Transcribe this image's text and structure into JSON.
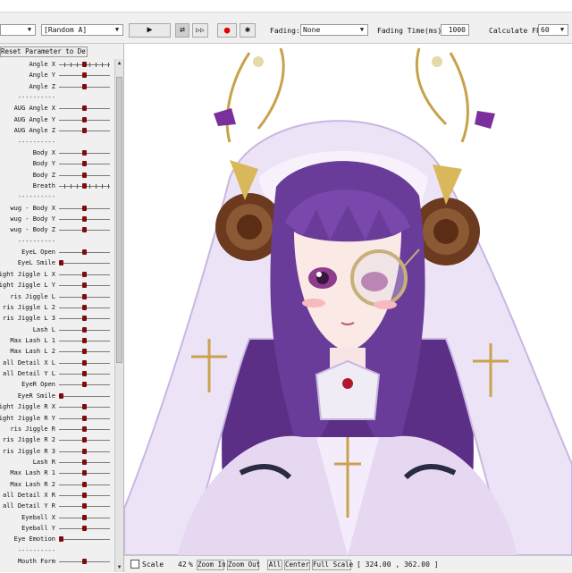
{
  "toolbar": {
    "motion_select": "",
    "preset_select": "[Random A]",
    "play_icon": "▶",
    "loop_icon": "⇄",
    "skip_icon": "▷▷",
    "record_icon": "●",
    "settings_icon": "✱",
    "fading_label": "Fading:",
    "fading_value": "None",
    "fading_time_label": "Fading Time(ms):",
    "fading_time_value": "1000",
    "fps_label": "Calculate FPS",
    "fps_value": "60"
  },
  "params": {
    "reset_label": "Reset Parameter to Default",
    "rows": [
      {
        "label": "Angle X",
        "knob": "ticks"
      },
      {
        "label": "Angle Y",
        "knob": "center"
      },
      {
        "label": "Angle Z",
        "knob": "center"
      },
      {
        "label": "----------",
        "knob": "none"
      },
      {
        "label": "AUG Angle X",
        "knob": "center"
      },
      {
        "label": "AUG Angle Y",
        "knob": "center"
      },
      {
        "label": "AUG Angle Z",
        "knob": "center"
      },
      {
        "label": "----------",
        "knob": "none"
      },
      {
        "label": "Body X",
        "knob": "center"
      },
      {
        "label": "Body Y",
        "knob": "center"
      },
      {
        "label": "Body Z",
        "knob": "center"
      },
      {
        "label": "Breath",
        "knob": "ticks"
      },
      {
        "label": "----------",
        "knob": "none"
      },
      {
        "label": "wug - Body X",
        "knob": "center"
      },
      {
        "label": "wug - Body Y",
        "knob": "center"
      },
      {
        "label": "wug - Body Z",
        "knob": "center"
      },
      {
        "label": "----------",
        "knob": "none"
      },
      {
        "label": "EyeL Open",
        "knob": "center"
      },
      {
        "label": "EyeL Smile",
        "knob": "start"
      },
      {
        "label": "ight Jiggle L X",
        "knob": "center"
      },
      {
        "label": "ight Jiggle L Y",
        "knob": "center"
      },
      {
        "label": "ris Jiggle L",
        "knob": "center"
      },
      {
        "label": "ris Jiggle L 2",
        "knob": "center"
      },
      {
        "label": "ris Jiggle L 3",
        "knob": "center"
      },
      {
        "label": "Lash L",
        "knob": "center"
      },
      {
        "label": "Max Lash L 1",
        "knob": "center"
      },
      {
        "label": "Max Lash L 2",
        "knob": "center"
      },
      {
        "label": "all Detail X L",
        "knob": "center"
      },
      {
        "label": "all Detail Y L",
        "knob": "center"
      },
      {
        "label": "EyeR Open",
        "knob": "center"
      },
      {
        "label": "EyeR Smile",
        "knob": "start"
      },
      {
        "label": "ight Jiggle R X",
        "knob": "center"
      },
      {
        "label": "ight Jiggle R Y",
        "knob": "center"
      },
      {
        "label": "ris Jiggle R",
        "knob": "center"
      },
      {
        "label": "ris Jiggle R 2",
        "knob": "center"
      },
      {
        "label": "ris Jiggle R 3",
        "knob": "center"
      },
      {
        "label": "Lash R",
        "knob": "center"
      },
      {
        "label": "Max Lash R 1",
        "knob": "center"
      },
      {
        "label": "Max Lash R 2",
        "knob": "center"
      },
      {
        "label": "all Detail X R",
        "knob": "center"
      },
      {
        "label": "all Detail Y R",
        "knob": "center"
      },
      {
        "label": "Eyeball X",
        "knob": "center"
      },
      {
        "label": "Eyeball Y",
        "knob": "center"
      },
      {
        "label": "Eye Emotion",
        "knob": "start"
      },
      {
        "label": "----------",
        "knob": "none"
      },
      {
        "label": "Mouth Form",
        "knob": "center"
      }
    ]
  },
  "status": {
    "scale_label": "Scale",
    "zoom_value": "42",
    "zoom_unit": "%",
    "zoom_in": "Zoom In",
    "zoom_out": "Zoom Out",
    "all": "All",
    "center": "Center",
    "full_scale": "Full Scale",
    "coords": "[ 324.00 , 362.00 ]"
  },
  "colors": {
    "knob": "#7d0d0d",
    "record": "#e00000",
    "hair": "#6a3c99",
    "veil": "#ece4f6"
  }
}
